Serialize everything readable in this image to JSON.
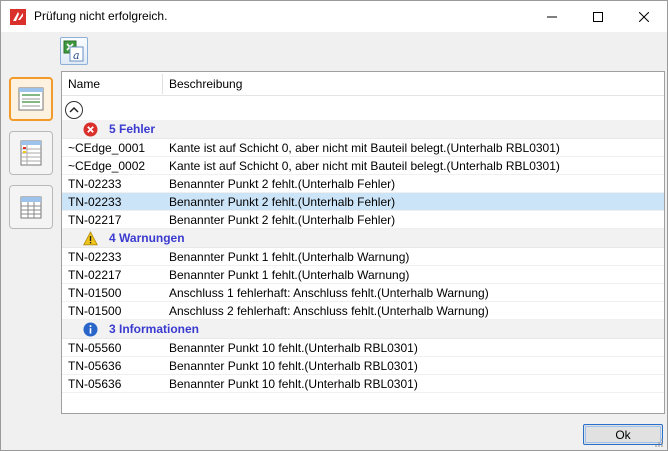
{
  "window": {
    "title": "Prüfung nicht erfolgreich."
  },
  "columns": {
    "name": "Name",
    "description": "Beschreibung"
  },
  "groups": {
    "errors": {
      "label": "5 Fehler",
      "icon": "error-icon",
      "color": "#d9302c",
      "rows": [
        {
          "name": "~CEdge_0001",
          "description": "Kante ist auf Schicht 0, aber nicht mit Bauteil belegt.(Unterhalb RBL0301)"
        },
        {
          "name": "~CEdge_0002",
          "description": "Kante ist auf Schicht 0, aber nicht mit Bauteil belegt.(Unterhalb RBL0301)"
        },
        {
          "name": "TN-02233",
          "description": "Benannter Punkt 2 fehlt.(Unterhalb Fehler)"
        },
        {
          "name": "TN-02233",
          "description": "Benannter Punkt 2 fehlt.(Unterhalb Fehler)"
        },
        {
          "name": "TN-02217",
          "description": "Benannter Punkt 2 fehlt.(Unterhalb Fehler)"
        }
      ]
    },
    "warnings": {
      "label": "4 Warnungen",
      "icon": "warning-icon",
      "color": "#f0c419",
      "rows": [
        {
          "name": "TN-02233",
          "description": "Benannter Punkt 1 fehlt.(Unterhalb Warnung)"
        },
        {
          "name": "TN-02217",
          "description": "Benannter Punkt 1 fehlt.(Unterhalb Warnung)"
        },
        {
          "name": "TN-01500",
          "description": "Anschluss 1 fehlerhaft: Anschluss fehlt.(Unterhalb Warnung)"
        },
        {
          "name": "TN-01500",
          "description": "Anschluss 2 fehlerhaft: Anschluss fehlt.(Unterhalb Warnung)"
        }
      ]
    },
    "infos": {
      "label": "3 Informationen",
      "icon": "info-icon",
      "color": "#2a66c9",
      "rows": [
        {
          "name": "TN-05560",
          "description": "Benannter Punkt 10 fehlt.(Unterhalb RBL0301)"
        },
        {
          "name": "TN-05636",
          "description": "Benannter Punkt 10 fehlt.(Unterhalb RBL0301)"
        },
        {
          "name": "TN-05636",
          "description": "Benannter Punkt 10 fehlt.(Unterhalb RBL0301)"
        }
      ]
    }
  },
  "selected_row": "errors.3",
  "buttons": {
    "ok": "Ok"
  },
  "colors": {
    "selection": "#cce4f7",
    "group_label": "#3a3ad0",
    "active_view_border": "#f29a2a"
  }
}
